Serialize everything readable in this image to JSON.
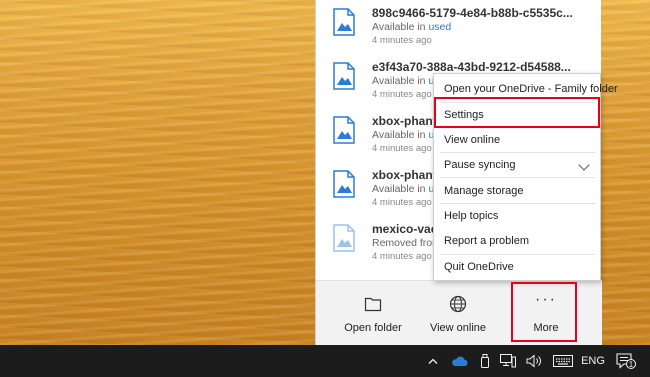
{
  "files": [
    {
      "name": "898c9466-5179-4e84-b88b-c5535c...",
      "status_prefix": "Available in ",
      "status_link": "used",
      "time": "4 minutes ago"
    },
    {
      "name": "e3f43a70-388a-43bd-9212-d54588...",
      "status_prefix": "Available in ",
      "status_link": "use",
      "time": "4 minutes ago"
    },
    {
      "name": "xbox-phanto",
      "status_prefix": "Available in ",
      "status_link": "us",
      "time": "4 minutes ago"
    },
    {
      "name": "xbox-phanto",
      "status_prefix": "Available in ",
      "status_link": "us",
      "time": "4 minutes ago"
    },
    {
      "name": "mexico-vaca",
      "status_prefix": "Removed from",
      "status_link": "",
      "time": "4 minutes ago"
    }
  ],
  "bottom_bar": {
    "open_folder": "Open folder",
    "view_online": "View online",
    "more": "More",
    "more_dots": "···"
  },
  "menu": {
    "open_family_folder": "Open your OneDrive - Family folder",
    "settings": "Settings",
    "view_online": "View online",
    "pause_syncing": "Pause syncing",
    "manage_storage": "Manage storage",
    "help_topics": "Help topics",
    "report_problem": "Report a problem",
    "quit": "Quit OneDrive"
  },
  "taskbar": {
    "language": "ENG",
    "notification_count": "1"
  },
  "colors": {
    "highlight": "#e2001a",
    "link": "#2b79d6",
    "onedrive_blue": "#2b7cd3",
    "taskbar": "#1c1c1c"
  },
  "icons": [
    "image-file-icon",
    "folder-icon",
    "globe-icon",
    "more-icon",
    "chevron-up-icon",
    "onedrive-cloud-icon",
    "usb-drive-icon",
    "network-icon",
    "volume-icon",
    "keyboard-icon",
    "action-center-icon"
  ]
}
